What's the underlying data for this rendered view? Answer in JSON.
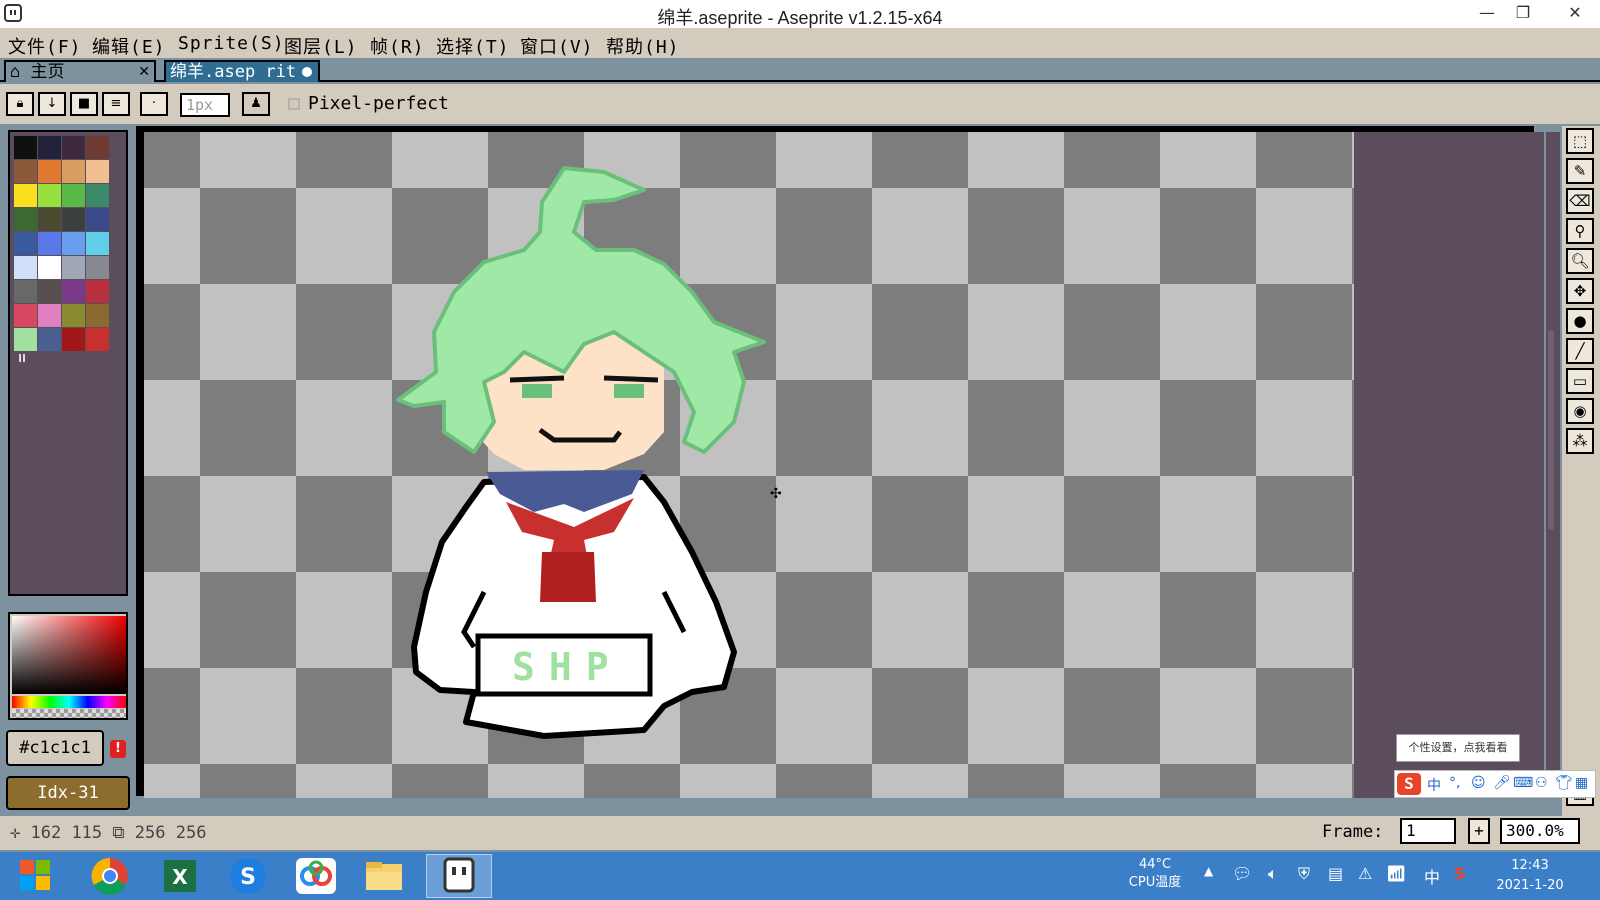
{
  "window": {
    "title": "绵羊.aseprite - Aseprite v1.2.15-x64"
  },
  "menu": [
    "文件(F)",
    "编辑(E)",
    "Sprite(S)",
    "图层(L)",
    "帧(R)",
    "选择(T)",
    "窗口(V)",
    "帮助(H)"
  ],
  "tabs": {
    "home": "主页",
    "file": "绵羊.asep rit"
  },
  "context_bar": {
    "brush_size_placeholder": "1px",
    "pixel_perfect_label": "Pixel-perfect"
  },
  "palette": [
    "#101010",
    "#22223a",
    "#3e2a3e",
    "#6e3a32",
    "#8a5a3a",
    "#e07830",
    "#d8a060",
    "#f0c090",
    "#f8e020",
    "#98e040",
    "#58b848",
    "#3a8a6a",
    "#3a6a30",
    "#4a4a30",
    "#3a4040",
    "#3a4a88",
    "#3a5aa0",
    "#5a78e8",
    "#68a0f0",
    "#60d0e8",
    "#d0e0f8",
    "#ffffff",
    "#a0a8b8",
    "#888890",
    "#686868",
    "#585050",
    "#7a3a8a",
    "#b83040",
    "#d84860",
    "#e080c0",
    "#8a8a30",
    "#8a6a30",
    "#a0e0a0",
    "#4a6090",
    "#a01818",
    "#c83030"
  ],
  "color": {
    "hex": "#c1c1c1",
    "index": "Idx-31"
  },
  "status": {
    "coords": "162  115",
    "size": "256  256",
    "frame_label": "Frame:",
    "frame_value": "1",
    "frame_plus": "+",
    "zoom": "300.0%"
  },
  "ime": {
    "tooltip": "个性设置，点我看看",
    "logo": "S",
    "mode": "中"
  },
  "tray": {
    "temp": "44°C",
    "temp_label": "CPU温度",
    "time": "12:43",
    "date": "2021-1-20",
    "ime": "中"
  },
  "sprite_text": "SHP"
}
